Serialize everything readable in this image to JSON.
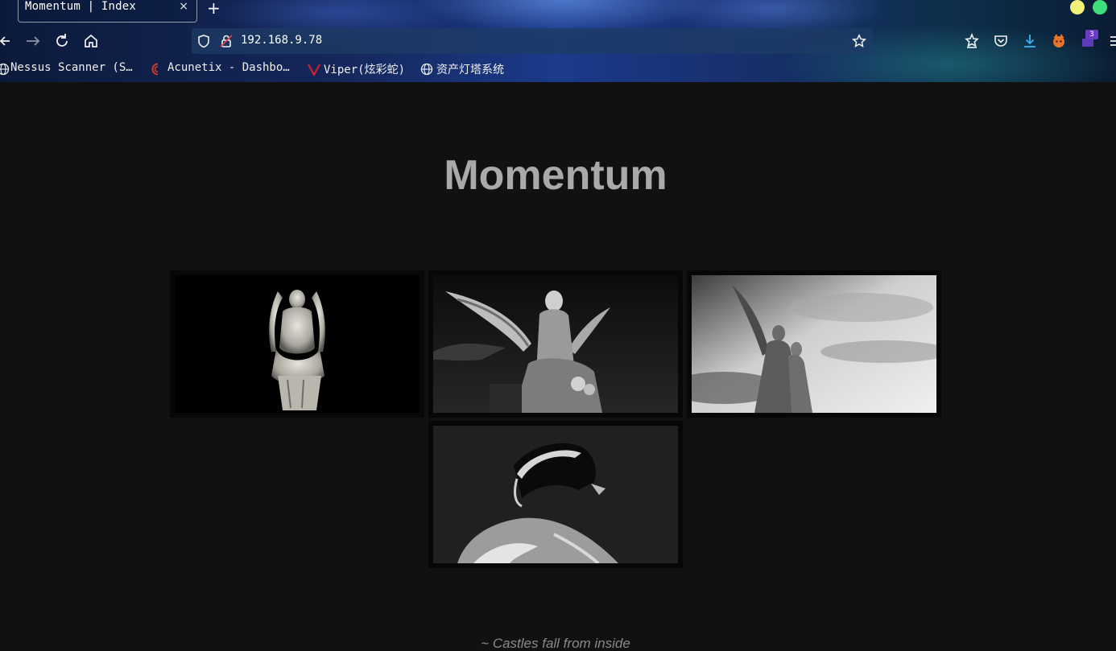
{
  "browser": {
    "tab": {
      "title": "Momentum | Index",
      "close": "×"
    },
    "new_tab": "+",
    "url": "192.168.9.78",
    "extension_badge": "3",
    "bookmarks": [
      {
        "label": "Nessus Scanner (S…",
        "icon": "globe-icon"
      },
      {
        "label": "Acunetix - Dashbo…",
        "icon": "acunetix-icon"
      },
      {
        "label": "Viper(炫彩蛇)",
        "icon": "viper-icon"
      },
      {
        "label": "资产灯塔系统",
        "icon": "globe-icon"
      }
    ],
    "colors": {
      "minimize": "#f4f17a",
      "maximize": "#3ee07c",
      "badge": "#6a3cc8",
      "download": "#35b6f2"
    }
  },
  "page": {
    "title": "Momentum",
    "gallery": [
      {
        "alt": "statue-fallen-angel-kneeling"
      },
      {
        "alt": "statue-angel-wings-seated"
      },
      {
        "alt": "statue-angel-sky"
      },
      {
        "alt": "statue-face-shadow"
      }
    ],
    "tagline": "~ Castles fall from inside"
  }
}
